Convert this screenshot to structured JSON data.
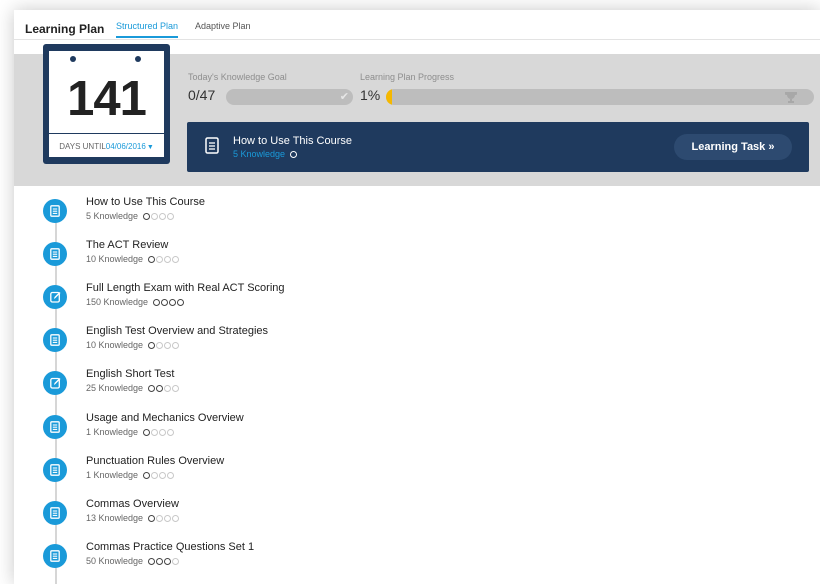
{
  "header": {
    "title": "Learning Plan",
    "tabs": [
      {
        "label": "Structured Plan",
        "active": true
      },
      {
        "label": "Adaptive Plan",
        "active": false
      }
    ]
  },
  "countdown": {
    "days": "141",
    "until_prefix": "DAYS UNTIL",
    "date": "04/06/2016"
  },
  "goal": {
    "label": "Today's Knowledge Goal",
    "value": "0/47"
  },
  "progress": {
    "label": "Learning Plan Progress",
    "value": "1%",
    "percent": 1
  },
  "current_course": {
    "title": "How to Use This Course",
    "subtitle": "5 Knowledge",
    "button_label": "Learning Task »"
  },
  "items": [
    {
      "title": "How to Use This Course",
      "knowledge": "5 Knowledge",
      "icon": "document-icon",
      "level": 1
    },
    {
      "title": "The ACT Review",
      "knowledge": "10 Knowledge",
      "icon": "document-icon",
      "level": 1
    },
    {
      "title": "Full Length Exam with Real ACT Scoring",
      "knowledge": "150 Knowledge",
      "icon": "edit-icon",
      "level": 4
    },
    {
      "title": "English Test Overview and Strategies",
      "knowledge": "10 Knowledge",
      "icon": "document-icon",
      "level": 1
    },
    {
      "title": "English Short Test",
      "knowledge": "25 Knowledge",
      "icon": "edit-icon",
      "level": 2
    },
    {
      "title": "Usage and Mechanics Overview",
      "knowledge": "1 Knowledge",
      "icon": "document-icon",
      "level": 1
    },
    {
      "title": "Punctuation Rules Overview",
      "knowledge": "1 Knowledge",
      "icon": "document-icon",
      "level": 1
    },
    {
      "title": "Commas Overview",
      "knowledge": "13 Knowledge",
      "icon": "document-icon",
      "level": 1
    },
    {
      "title": "Commas Practice Questions Set 1",
      "knowledge": "50 Knowledge",
      "icon": "document-icon",
      "level": 3
    }
  ],
  "colors": {
    "accent": "#1a9ad9",
    "navy": "#1f3a5e",
    "banner": "#d8d8d8",
    "progress": "#f5b800"
  }
}
